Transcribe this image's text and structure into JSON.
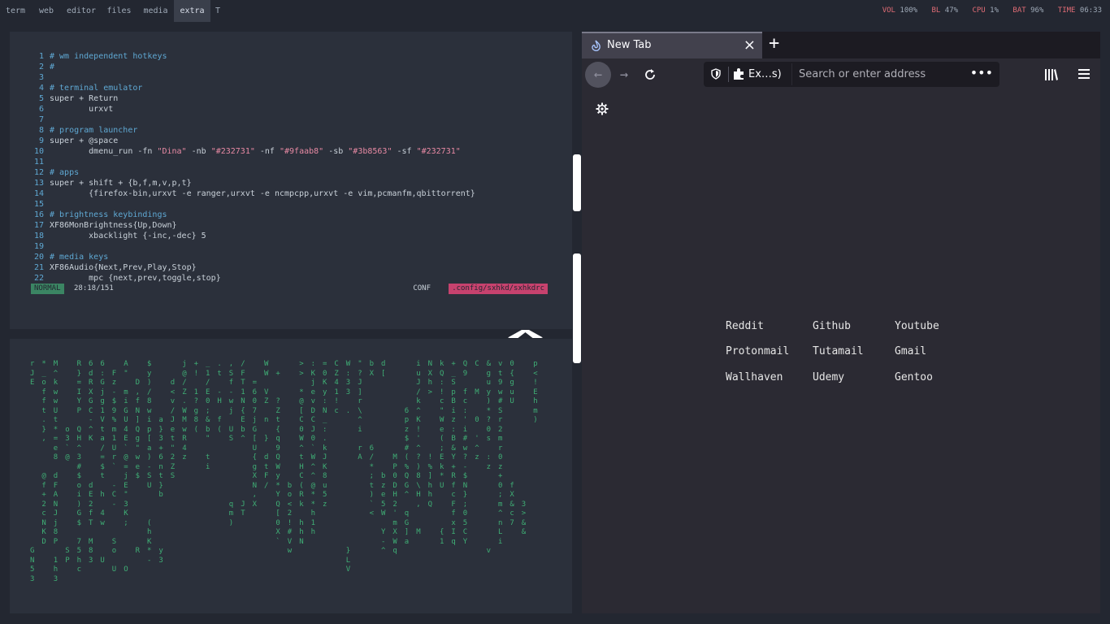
{
  "workspaces": [
    {
      "label": "term",
      "active": false
    },
    {
      "label": "web",
      "active": false
    },
    {
      "label": "editor",
      "active": false
    },
    {
      "label": "files",
      "active": false
    },
    {
      "label": "media",
      "active": false
    },
    {
      "label": "extra",
      "active": true
    },
    {
      "label": "T",
      "active": false
    }
  ],
  "status": {
    "vol_label": "VOL",
    "vol": "100%",
    "bl_label": "BL",
    "bl": "47%",
    "cpu_label": "CPU",
    "cpu": "1%",
    "bat_label": "BAT",
    "bat": "96%",
    "time_label": "TIME",
    "time": "06:33"
  },
  "editor": {
    "lines": [
      {
        "n": "1",
        "text": "# wm independent hotkeys",
        "kind": "comment"
      },
      {
        "n": "2",
        "text": "#",
        "kind": "comment"
      },
      {
        "n": "3",
        "text": "",
        "kind": "text"
      },
      {
        "n": "4",
        "text": "# terminal emulator",
        "kind": "comment"
      },
      {
        "n": "5",
        "text": "super + Return",
        "kind": "text"
      },
      {
        "n": "6",
        "text": "        urxvt",
        "kind": "text"
      },
      {
        "n": "7",
        "text": "",
        "kind": "text"
      },
      {
        "n": "8",
        "text": "# program launcher",
        "kind": "comment"
      },
      {
        "n": "9",
        "text": "super + @space",
        "kind": "text"
      },
      {
        "n": "10",
        "text": "        dmenu_run -fn \"Dina\" -nb \"#232731\" -nf \"#9faab8\" -sb \"#3b8563\" -sf \"#232731\"",
        "kind": "dmenu"
      },
      {
        "n": "11",
        "text": "",
        "kind": "text"
      },
      {
        "n": "12",
        "text": "# apps",
        "kind": "comment"
      },
      {
        "n": "13",
        "text": "super + shift + {b,f,m,v,p,t}",
        "kind": "text"
      },
      {
        "n": "14",
        "text": "        {firefox-bin,urxvt -e ranger,urxvt -e ncmpcpp,urxvt -e vim,pcmanfm,qbittorrent}",
        "kind": "text"
      },
      {
        "n": "15",
        "text": "",
        "kind": "text"
      },
      {
        "n": "16",
        "text": "# brightness keybindings",
        "kind": "comment"
      },
      {
        "n": "17",
        "text": "XF86MonBrightness{Up,Down}",
        "kind": "text"
      },
      {
        "n": "18",
        "text": "        xbacklight {-inc,-dec} 5",
        "kind": "text"
      },
      {
        "n": "19",
        "text": "",
        "kind": "text"
      },
      {
        "n": "20",
        "text": "# media keys",
        "kind": "comment"
      },
      {
        "n": "21",
        "text": "XF86Audio{Next,Prev,Play,Stop}",
        "kind": "text"
      },
      {
        "n": "22",
        "text": "        mpc {next,prev,toggle,stop}",
        "kind": "text"
      }
    ],
    "mode": "NORMAL",
    "position": "28:18/151",
    "filetype": "CONF",
    "filename": ".config/sxhkd/sxhkdrc"
  },
  "matrix_columns": [
    "r\nJ\nE\n\n\n\n\n\n\n\n\n\n\n\n\n\n\n\n\n\nG\nN\n5\n3",
    "*\n_\no\nf\nf\nt\n.\n}\n,\n\n\n\n@\nf\n+\n2\nc\nN\nK\nD",
    "M\n^\nk\nw\nw\nU\nt\n*\n=\ne\n8\n\nd\nF\nA\nN\nJ\nj\n8\nP\n\n1\nh\n3",
    "\n\n\n\n\n\n\no\n3\n`\n@\n\n\n\n\n\n\n\n\n\nS\nP\n\n",
    "R\n}\n=\nI\nY\nP\n\nQ\nH\n^\n3\n#\n$\no\ni\n)\nG\n$\n\n7\n5\nh\nc",
    "6\nd\nR\nX\nG\nC\n-\n^\nK\n\n\n\n\nd\nE\n2\nf\nT\n\nM\n8\n3",
    "6\n:\nG\nj\ng\n1\nV\nt\na\n/\n=\n$\nt\n\nh\n\n4\nw\n\n\n\nU",
    "\nF\nz\n-\n$\n9\n%\nm\n1\nU\nr\n`\n\n-\nC\n-\n\n\n\nS\no\n\nU",
    "A\n\"\n\nm\ni\nG\nU\n4\nE\n`\n@\n=\nj\nE\n\"\n3\nK\n;\n\n\n\n\nO",
    "\n\nD\n,\nf\nN\n]\nQ\ng\n\"\nw\ne\n$\n\n\n\n\n\n\n\nR",
    "$\ny\n)\n/\n8\nw\ni\np\n[\na\n)\n-\nS\nU\n\n\n\n(\nh\nK\n*\n-",
    "\n\n\n\n\n\na\n}\n3\n+\n6\nn\nt\n}\nb\n\n\n\n\n\ny\n3",
    "\n\nd\n<\nv\n/\nJ\ne\nt\n\"\n2\nZ\nS\n\n\n\n\n\n\n\n\n\n",
    "j\n@\n/\nZ\n.\nW\nM\nw\nR\n4\nz\n\n\n\n\n\n\n\n\n\n\n",
    "+\n!\n\n1\n?\ng\n8\n(\n\n\n\n\n\n\n\n\n\n\n\n\n\n",
    "_\n1\n/\nE\n0\n;\n&\nb\n\"\n\nt\ni\n\n\n\n\n\n\n\n\n\n",
    ".\nt\n\n-\nH\n\nf\n(\n\n\n\n\n\n\n\n\n\n\n\n\n",
    ",\nS\nf\n-\nw\nj\n\nU\nS\n\n\n\n\n\n\nq\nm\n)",
    "/\nF\nT\n1\nN\n{\nE\nb\n^\n\n\n\n\n\n\nJ\nT\n\n",
    "\n\n=\n6\n0\n7\nj\nG\n[\nU\n{\ng\nX\nN\n,\nX\n\n\n\n\n",
    "W\nW\n\nV\nZ\n\nn\n\n}\n\nd\nt\nF\n/\n\n",
    "\n+\n\n\n?\nZ\nt\n{\nq\n9\nQ\nW\ny\n*\nY\nQ\n[\n0\nX\n`",
    "\n\n\n\n\n\n\n\n\n\n\n\n\nb\no\n<\n2\n!\n#\nV\nw",
    ">\n>\n\n*\n@\n[\nC\n0\nW\n^\nt\nH\nC\n(\nR\nk\n\nh\nh\nN",
    ":\nK\nj\ne\nv\nD\nC\nJ\n0\n`\nW\n^\n^\n@\n*\n*\nh\n1\nh",
    "=\n0\nK\ny\n:\nN\n_\n:\n.\nk\nJ\nK\n8\nu\n5\nz",
    "C\nZ\n4\n1\n!\nc\n\n\n\n\n\n\n\n\n\n\n\n\n\n\n\n\n\n",
    "W\n:\n3\n3\n\n.\n\n\n\n\n\n\n\n\n\n\n\n\n\n\n}\nL\nV",
    "\"\n?\nJ\n]\nr\n\\\n^\ni\n\nr\nA\n\n\n\n\n\n\n\n\n\n\n",
    "b\nX\n\n\n\n\n\n\n\n6\n/\n*\n;\nt\n)\n`\n<\n\n\n\n\n\n",
    "d\n[\n\n\n\n\n\n\n\n\n\n\nb\nz\ne\n5\nW\n\nY\n-\n^",
    "\n\n\n\n\n\n\n\n\n\nM\nP\n0\nD\nH\n2\n'\nm\nX\nW\nq",
    "\n\n\n\n\n6\np\nz\n$\n#\n(\n%\nQ\nG\n^\n\nq\nG\n]\na",
    "i\nu\nJ\n/\nk\n^\nK\n!\n'\n^\n?\n)\n8\n\\\nH\n,\n\n\nM",
    "N\nX\nh\n>\n\n\n\n\n\n\n!\n%\n]\nh\nh\nQ",
    "k\nQ\n:\n!\nc\n\"\nW\ne\n(\n;\nE\nk\n*\nU\n\n\n\n\n{\n1",
    "+\n_\nS\np\nB\ni\nz\n:\nB\n&\nY\n+\nR\nf\nc\nF\nf\nx\nI\nq",
    "Q\n9\n\nf\nc\n:\n'\ni\n#\nw\n?\n-\n$\nN\n}\n;\n0\n5\nC\nY",
    "C\n\n\nM\n\n\n0\n\n'\n^\nz\n\n\n\n\n\n\n\n\n\n",
    "&\ng\nu\ny\n)\n*\n?\n0\ns\n\n:\nz\n\n\n\n\n\n\n\n\nv",
    "v\nt\n9\nw\n#\nS\nr\n2\nm\nr\n0\nz\n+\n0\n;\nm\n^\nn\nL\ni",
    "0\n{\ng\nu\nU\n\n\n\n\n\n\n\n\nf\nX\n&\nc\n7",
    "\n\n\n\n\n\n\n\n\n\n\n\n\n\n\n3\n>\n&\n&",
    "p\n<\n!\nE\nh\nm\n)\n\n\n\n\n\n\n\n\n\n\n"
  ],
  "browser": {
    "tab_title": "New Tab",
    "tab_close_icon": "close-icon",
    "new_tab_icon": "plus-icon",
    "extension_label": "Ex…s)",
    "search_placeholder": "Search or enter address",
    "more_icon": "•••",
    "links": [
      {
        "label": "Reddit"
      },
      {
        "label": "Github"
      },
      {
        "label": "Youtube"
      },
      {
        "label": "Protonmail"
      },
      {
        "label": "Tutamail"
      },
      {
        "label": "Gmail"
      },
      {
        "label": "Wallhaven"
      },
      {
        "label": "Udemy"
      },
      {
        "label": "Gentoo"
      }
    ]
  },
  "colors": {
    "bg": "#232731",
    "panel": "#2b303b",
    "comment": "#5fa8d3",
    "string": "#e88aa4",
    "mode_bg": "#3b8563",
    "file_bg": "#c7426e",
    "matrix": "#3fae75",
    "status_key": "#e06c75"
  }
}
